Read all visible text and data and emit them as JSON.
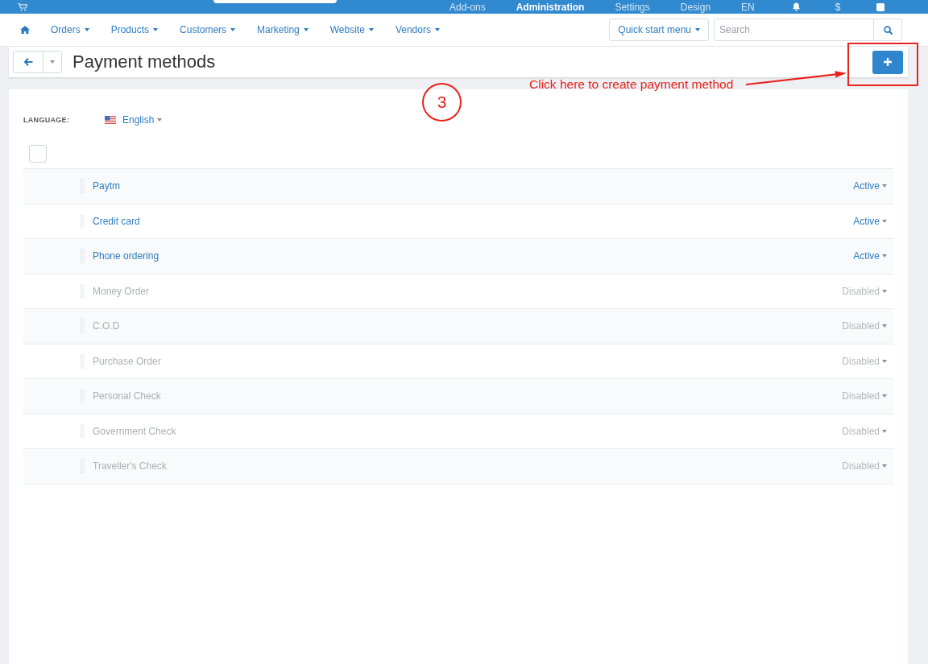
{
  "top_bar": {
    "items": [
      {
        "label": "Add-ons",
        "selected": false
      },
      {
        "label": "Administration",
        "selected": true
      },
      {
        "label": "Settings",
        "selected": false
      },
      {
        "label": "Design",
        "selected": false
      },
      {
        "label": "EN",
        "selected": false
      }
    ],
    "currency": "$"
  },
  "nav": {
    "items": [
      "Orders",
      "Products",
      "Customers",
      "Marketing",
      "Website",
      "Vendors"
    ],
    "quick_start": "Quick start menu",
    "search": {
      "placeholder": "Search"
    }
  },
  "header": {
    "title": "Payment methods"
  },
  "language": {
    "label": "LANGUAGE:",
    "value": "English"
  },
  "select_all": {
    "checked": false
  },
  "payment_methods": [
    {
      "name": "Paytm",
      "status": "Active",
      "disabled": false
    },
    {
      "name": "Credit card",
      "status": "Active",
      "disabled": false
    },
    {
      "name": "Phone ordering",
      "status": "Active",
      "disabled": false
    },
    {
      "name": "Money Order",
      "status": "Disabled",
      "disabled": true
    },
    {
      "name": "C.O.D",
      "status": "Disabled",
      "disabled": true
    },
    {
      "name": "Purchase Order",
      "status": "Disabled",
      "disabled": true
    },
    {
      "name": "Personal Check",
      "status": "Disabled",
      "disabled": true
    },
    {
      "name": "Government Check",
      "status": "Disabled",
      "disabled": true
    },
    {
      "name": "Traveller's Check",
      "status": "Disabled",
      "disabled": true
    }
  ],
  "annotation": {
    "step": "3",
    "callout": "Click here to create payment method"
  }
}
